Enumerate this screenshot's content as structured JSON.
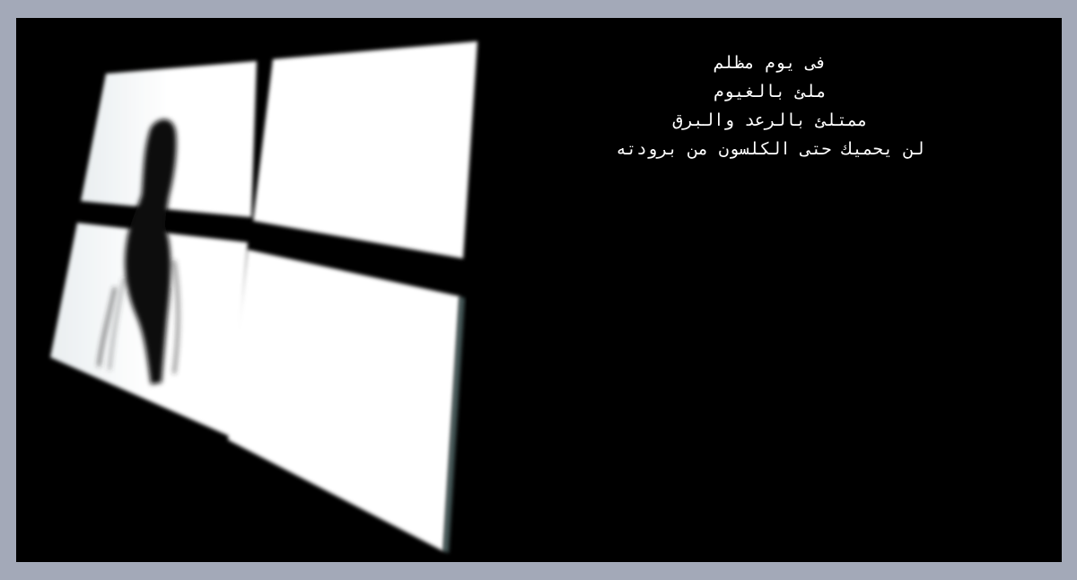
{
  "poem": {
    "lines": [
      "فى يوم مظلم",
      "ملئ بالغيوم",
      "ممتلئ بالرعد والبرق",
      "لن يحميك حتى الكلسون من برودته"
    ]
  },
  "colors": {
    "page_background": "#a3a9b8",
    "frame_background": "#000000",
    "window_light": "#ffffff",
    "text": "#ffffff"
  },
  "icons": {
    "illustration": "window-silhouette-illustration"
  }
}
